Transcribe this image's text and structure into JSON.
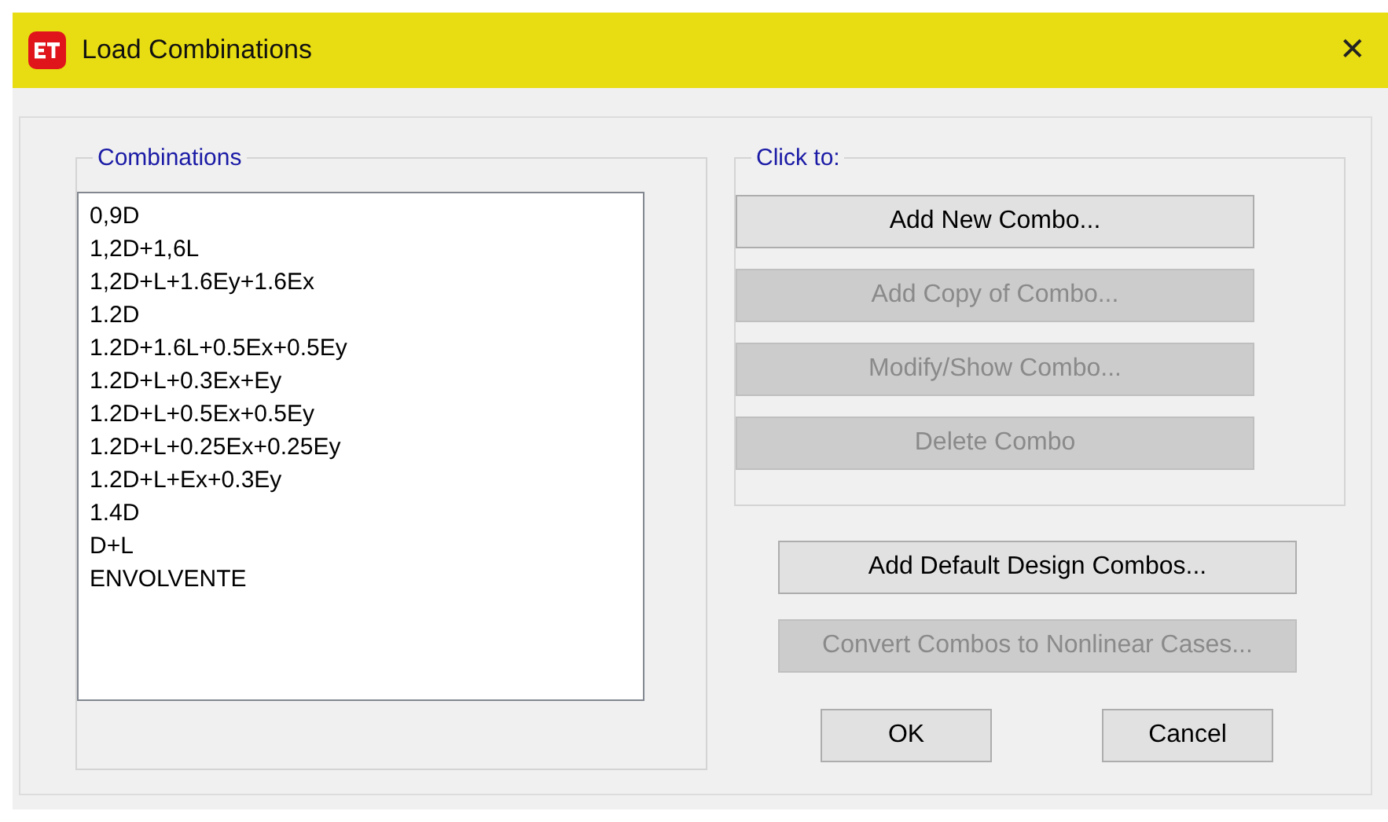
{
  "window": {
    "title": "Load Combinations",
    "close": "✕"
  },
  "combinations": {
    "label": "Combinations",
    "items": [
      {
        "text": "0,9D",
        "selected": false
      },
      {
        "text": "1,2D+1,6L",
        "selected": false
      },
      {
        "text": "1,2D+L+1.6Ey+1.6Ex",
        "selected": false
      },
      {
        "text": "1.2D",
        "selected": false
      },
      {
        "text": "1.2D+1.6L+0.5Ex+0.5Ey",
        "selected": false
      },
      {
        "text": "1.2D+L+0.3Ex+Ey",
        "selected": false
      },
      {
        "text": "1.2D+L+0.5Ex+0.5Ey",
        "selected": false
      },
      {
        "text": "1.2D+L+0.25Ex+0.25Ey",
        "selected": false
      },
      {
        "text": "1.2D+L+Ex+0.3Ey",
        "selected": false
      },
      {
        "text": "1.4D",
        "selected": false
      },
      {
        "text": "D+L",
        "selected": false
      },
      {
        "text": "ENVOLVENTE",
        "selected": false
      }
    ]
  },
  "click_to": {
    "label": "Click to:",
    "buttons": [
      {
        "label": "Add New Combo...",
        "disabled": false
      },
      {
        "label": "Add Copy of Combo...",
        "disabled": true
      },
      {
        "label": "Modify/Show Combo...",
        "disabled": true
      },
      {
        "label": "Delete Combo",
        "disabled": true
      }
    ]
  },
  "extra_buttons": [
    {
      "label": "Add Default Design Combos...",
      "disabled": false
    },
    {
      "label": "Convert Combos to Nonlinear Cases...",
      "disabled": true
    }
  ],
  "dialog_buttons": [
    {
      "label": "OK",
      "disabled": false
    },
    {
      "label": "Cancel",
      "disabled": false
    }
  ]
}
